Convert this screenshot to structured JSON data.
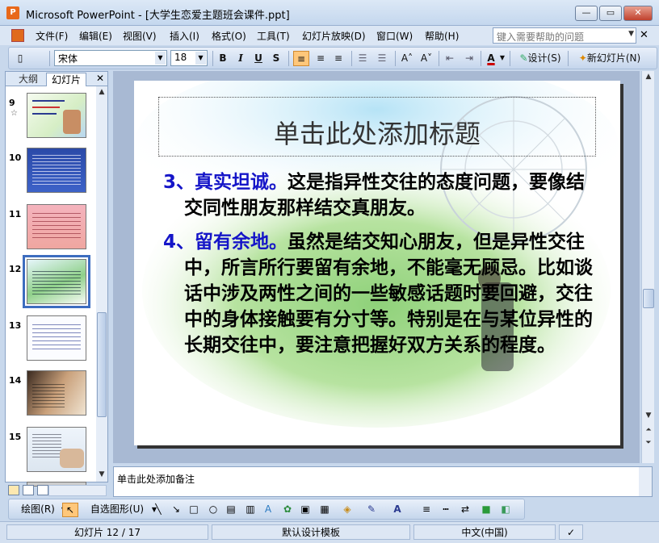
{
  "window": {
    "title": "Microsoft PowerPoint - [大学生恋爱主题班会课件.ppt]",
    "app_icon": "powerpoint-icon",
    "minimize": "—",
    "maximize": "▭",
    "close": "✕"
  },
  "menu": {
    "items": [
      "文件(F)",
      "编辑(E)",
      "视图(V)",
      "插入(I)",
      "格式(O)",
      "工具(T)",
      "幻灯片放映(D)",
      "窗口(W)",
      "帮助(H)"
    ],
    "help_placeholder": "键入需要帮助的问题",
    "close_glyph": "✕"
  },
  "format_toolbar": {
    "font": "宋体",
    "size": "18",
    "bold": "B",
    "italic": "I",
    "underline": "U",
    "shadow": "S",
    "font_color_glyph": "A",
    "design_label": "设计(S)",
    "new_slide_label": "新幻灯片(N)"
  },
  "left_pane": {
    "tabs": [
      "大纲",
      "幻灯片"
    ],
    "active_tab": "幻灯片",
    "close_glyph": "✕",
    "slides": [
      {
        "num": "9",
        "has_star": true
      },
      {
        "num": "10",
        "has_star": false
      },
      {
        "num": "11",
        "has_star": false
      },
      {
        "num": "12",
        "has_star": false,
        "selected": true
      },
      {
        "num": "13",
        "has_star": false
      },
      {
        "num": "14",
        "has_star": false
      },
      {
        "num": "15",
        "has_star": false
      }
    ],
    "star_glyph": "☆"
  },
  "slide": {
    "title_placeholder": "单击此处添加标题",
    "paragraphs": [
      {
        "lead": "3、真实坦诚。",
        "text": "这是指异性交往的态度问题，要像结交同性朋友那样结交真朋友。"
      },
      {
        "lead": "4、留有余地。",
        "text": "虽然是结交知心朋友，但是异性交往中，所言所行要留有余地，不能毫无顾忌。比如谈话中涉及两性之间的一些敏感话题时要回避，交往中的身体接触要有分寸等。特别是在与某位异性的长期交往中，要注意把握好双方关系的程度。"
      }
    ],
    "lead_color": "#1515c8"
  },
  "notes": {
    "placeholder": "单击此处添加备注"
  },
  "drawing_toolbar": {
    "draw_label": "绘图(R)",
    "autoshapes_label": "自选图形(U)"
  },
  "status": {
    "slide_pos": "幻灯片 12 / 17",
    "template": "默认设计模板",
    "language": "中文(中国)"
  }
}
